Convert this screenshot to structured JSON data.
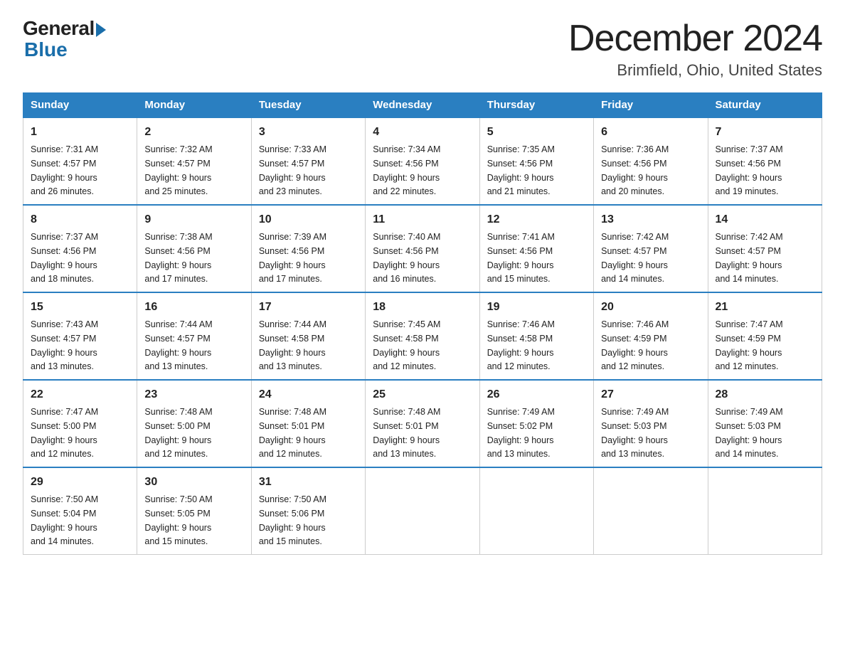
{
  "logo": {
    "general": "General",
    "blue": "Blue"
  },
  "header": {
    "month": "December 2024",
    "location": "Brimfield, Ohio, United States"
  },
  "weekdays": [
    "Sunday",
    "Monday",
    "Tuesday",
    "Wednesday",
    "Thursday",
    "Friday",
    "Saturday"
  ],
  "weeks": [
    [
      {
        "day": "1",
        "sunrise": "7:31 AM",
        "sunset": "4:57 PM",
        "daylight": "9 hours and 26 minutes."
      },
      {
        "day": "2",
        "sunrise": "7:32 AM",
        "sunset": "4:57 PM",
        "daylight": "9 hours and 25 minutes."
      },
      {
        "day": "3",
        "sunrise": "7:33 AM",
        "sunset": "4:57 PM",
        "daylight": "9 hours and 23 minutes."
      },
      {
        "day": "4",
        "sunrise": "7:34 AM",
        "sunset": "4:56 PM",
        "daylight": "9 hours and 22 minutes."
      },
      {
        "day": "5",
        "sunrise": "7:35 AM",
        "sunset": "4:56 PM",
        "daylight": "9 hours and 21 minutes."
      },
      {
        "day": "6",
        "sunrise": "7:36 AM",
        "sunset": "4:56 PM",
        "daylight": "9 hours and 20 minutes."
      },
      {
        "day": "7",
        "sunrise": "7:37 AM",
        "sunset": "4:56 PM",
        "daylight": "9 hours and 19 minutes."
      }
    ],
    [
      {
        "day": "8",
        "sunrise": "7:37 AM",
        "sunset": "4:56 PM",
        "daylight": "9 hours and 18 minutes."
      },
      {
        "day": "9",
        "sunrise": "7:38 AM",
        "sunset": "4:56 PM",
        "daylight": "9 hours and 17 minutes."
      },
      {
        "day": "10",
        "sunrise": "7:39 AM",
        "sunset": "4:56 PM",
        "daylight": "9 hours and 17 minutes."
      },
      {
        "day": "11",
        "sunrise": "7:40 AM",
        "sunset": "4:56 PM",
        "daylight": "9 hours and 16 minutes."
      },
      {
        "day": "12",
        "sunrise": "7:41 AM",
        "sunset": "4:56 PM",
        "daylight": "9 hours and 15 minutes."
      },
      {
        "day": "13",
        "sunrise": "7:42 AM",
        "sunset": "4:57 PM",
        "daylight": "9 hours and 14 minutes."
      },
      {
        "day": "14",
        "sunrise": "7:42 AM",
        "sunset": "4:57 PM",
        "daylight": "9 hours and 14 minutes."
      }
    ],
    [
      {
        "day": "15",
        "sunrise": "7:43 AM",
        "sunset": "4:57 PM",
        "daylight": "9 hours and 13 minutes."
      },
      {
        "day": "16",
        "sunrise": "7:44 AM",
        "sunset": "4:57 PM",
        "daylight": "9 hours and 13 minutes."
      },
      {
        "day": "17",
        "sunrise": "7:44 AM",
        "sunset": "4:58 PM",
        "daylight": "9 hours and 13 minutes."
      },
      {
        "day": "18",
        "sunrise": "7:45 AM",
        "sunset": "4:58 PM",
        "daylight": "9 hours and 12 minutes."
      },
      {
        "day": "19",
        "sunrise": "7:46 AM",
        "sunset": "4:58 PM",
        "daylight": "9 hours and 12 minutes."
      },
      {
        "day": "20",
        "sunrise": "7:46 AM",
        "sunset": "4:59 PM",
        "daylight": "9 hours and 12 minutes."
      },
      {
        "day": "21",
        "sunrise": "7:47 AM",
        "sunset": "4:59 PM",
        "daylight": "9 hours and 12 minutes."
      }
    ],
    [
      {
        "day": "22",
        "sunrise": "7:47 AM",
        "sunset": "5:00 PM",
        "daylight": "9 hours and 12 minutes."
      },
      {
        "day": "23",
        "sunrise": "7:48 AM",
        "sunset": "5:00 PM",
        "daylight": "9 hours and 12 minutes."
      },
      {
        "day": "24",
        "sunrise": "7:48 AM",
        "sunset": "5:01 PM",
        "daylight": "9 hours and 12 minutes."
      },
      {
        "day": "25",
        "sunrise": "7:48 AM",
        "sunset": "5:01 PM",
        "daylight": "9 hours and 13 minutes."
      },
      {
        "day": "26",
        "sunrise": "7:49 AM",
        "sunset": "5:02 PM",
        "daylight": "9 hours and 13 minutes."
      },
      {
        "day": "27",
        "sunrise": "7:49 AM",
        "sunset": "5:03 PM",
        "daylight": "9 hours and 13 minutes."
      },
      {
        "day": "28",
        "sunrise": "7:49 AM",
        "sunset": "5:03 PM",
        "daylight": "9 hours and 14 minutes."
      }
    ],
    [
      {
        "day": "29",
        "sunrise": "7:50 AM",
        "sunset": "5:04 PM",
        "daylight": "9 hours and 14 minutes."
      },
      {
        "day": "30",
        "sunrise": "7:50 AM",
        "sunset": "5:05 PM",
        "daylight": "9 hours and 15 minutes."
      },
      {
        "day": "31",
        "sunrise": "7:50 AM",
        "sunset": "5:06 PM",
        "daylight": "9 hours and 15 minutes."
      },
      null,
      null,
      null,
      null
    ]
  ],
  "labels": {
    "sunrise": "Sunrise:",
    "sunset": "Sunset:",
    "daylight": "Daylight:"
  }
}
